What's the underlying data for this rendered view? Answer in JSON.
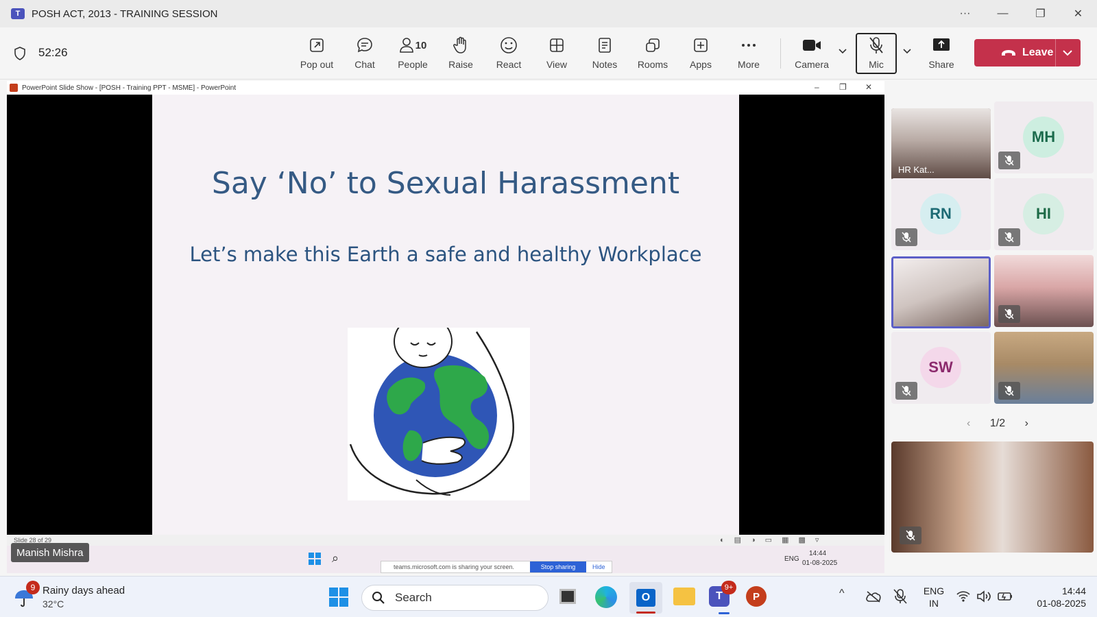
{
  "window": {
    "title": "POSH ACT, 2013 - TRAINING SESSION",
    "controls": [
      "···",
      "—",
      "❐",
      "✕"
    ]
  },
  "meeting": {
    "timer": "52:26",
    "toolbar": {
      "popout": "Pop out",
      "chat": "Chat",
      "people": "People",
      "people_count": "10",
      "raise": "Raise",
      "react": "React",
      "view": "View",
      "notes": "Notes",
      "rooms": "Rooms",
      "apps": "Apps",
      "more": "More",
      "camera": "Camera",
      "mic": "Mic",
      "share": "Share",
      "leave": "Leave"
    }
  },
  "share": {
    "ppt_title": "PowerPoint Slide Show - [POSH - Training PPT - MSME] - PowerPoint",
    "slide_title": "Say ‘No’ to Sexual Harassment",
    "slide_subtitle": "Let’s make this Earth a safe and healthy Workplace",
    "slide_counter": "Slide 28 of 29",
    "presenter": "Manish Mishra",
    "inner_taskbar": {
      "notice": "teams.microsoft.com is sharing your screen.",
      "stop": "Stop sharing",
      "hide": "Hide",
      "lang": "ENG",
      "time": "14:44",
      "date": "01-08-2025"
    }
  },
  "participants": [
    {
      "initials": "",
      "name": "HR Kat...",
      "type": "video"
    },
    {
      "initials": "MH",
      "name": "",
      "type": "avatar",
      "color": "#cdeee0",
      "text_color": "#1b6b4c"
    },
    {
      "initials": "RN",
      "name": "",
      "type": "avatar",
      "color": "#d6eef0",
      "text_color": "#1d6a74"
    },
    {
      "initials": "HI",
      "name": "",
      "type": "avatar",
      "color": "#d6eee3",
      "text_color": "#1d6b47"
    },
    {
      "initials": "",
      "name": "",
      "type": "video"
    },
    {
      "initials": "",
      "name": "",
      "type": "video"
    },
    {
      "initials": "SW",
      "name": "",
      "type": "avatar",
      "color": "#f4d8ea",
      "text_color": "#8c2a6d"
    },
    {
      "initials": "",
      "name": "",
      "type": "video"
    }
  ],
  "pager": "1/2",
  "taskbar": {
    "weather_title": "Rainy days ahead",
    "weather_temp": "32°C",
    "weather_badge": "9",
    "search": "Search",
    "teams_badge": "9+",
    "lang_top": "ENG",
    "lang_bottom": "IN",
    "time": "14:44",
    "date": "01-08-2025"
  },
  "colors": {
    "leave": "#c4314b",
    "slide_text": "#355a84",
    "accent": "#4b53bc"
  }
}
